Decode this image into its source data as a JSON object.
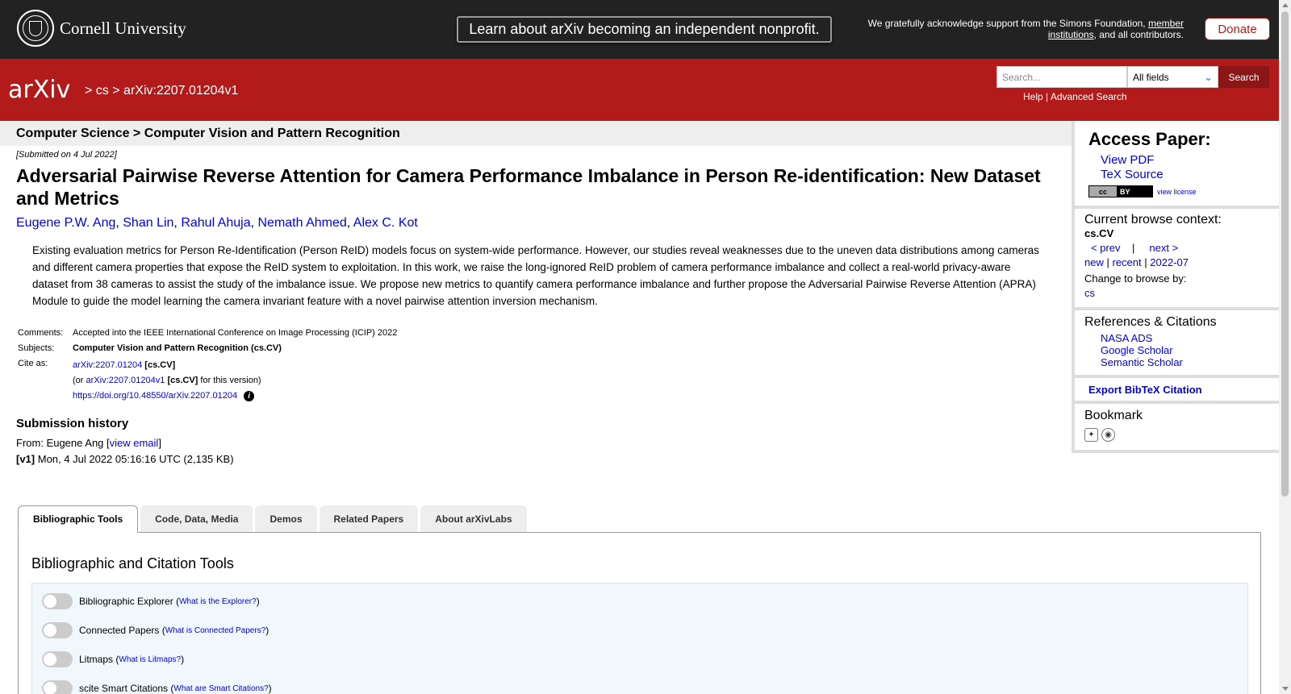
{
  "banner": {
    "cornell_label": "Cornell University",
    "nonprofit_label": "Learn about arXiv becoming an independent nonprofit.",
    "support_prefix": "We gratefully acknowledge support from the Simons Foundation,",
    "support_link": "member institutions",
    "support_suffix": ", and all contributors.",
    "donate_label": "Donate"
  },
  "header": {
    "logo_text": "arXiv",
    "crumb_sep1": ">",
    "crumb_cs": "cs",
    "crumb_sep2": ">",
    "crumb_id": "arXiv:2207.01204v1",
    "search_placeholder": "Search...",
    "search_field": "All fields",
    "search_button": "Search",
    "help": "Help",
    "sep": "|",
    "advanced": "Advanced Search"
  },
  "subheader": "Computer Science > Computer Vision and Pattern Recognition",
  "paper": {
    "submitted": "[Submitted on 4 Jul 2022]",
    "title": "Adversarial Pairwise Reverse Attention for Camera Performance Imbalance in Person Re-identification: New Dataset and Metrics",
    "authors": [
      "Eugene P.W. Ang",
      "Shan Lin",
      "Rahul Ahuja",
      "Nemath Ahmed",
      "Alex C. Kot"
    ],
    "abstract": "Existing evaluation metrics for Person Re-Identification (Person ReID) models focus on system-wide performance. However, our studies reveal weaknesses due to the uneven data distributions among cameras and different camera properties that expose the ReID system to exploitation. In this work, we raise the long-ignored ReID problem of camera performance imbalance and collect a real-world privacy-aware dataset from 38 cameras to assist the study of the imbalance issue. We propose new metrics to quantify camera performance imbalance and further propose the Adversarial Pairwise Reverse Attention (APRA) Module to guide the model learning the camera invariant feature with a novel pairwise attention inversion mechanism.",
    "comments_label": "Comments:",
    "comments": "Accepted into the IEEE International Conference on Image Processing (ICIP) 2022",
    "subjects_label": "Subjects:",
    "subjects": "Computer Vision and Pattern Recognition (cs.CV)",
    "cite_label": "Cite as:",
    "cite_id": "arXiv:2207.01204",
    "cite_cat": "[cs.CV]",
    "cite_or": "(or",
    "cite_version": "arXiv:2207.01204v1",
    "cite_cat2": "[cs.CV]",
    "cite_version_suffix": "for this version)",
    "doi": "https://doi.org/10.48550/arXiv.2207.01204",
    "history_title": "Submission history",
    "from_prefix": "From: Eugene Ang [",
    "view_email": "view email",
    "from_suffix": "]",
    "v1_label": "[v1]",
    "v1_text": "Mon, 4 Jul 2022 05:16:16 UTC (2,135 KB)"
  },
  "sidebar": {
    "access_title": "Access Paper:",
    "view_pdf": "View PDF",
    "tex_source": "TeX Source",
    "cc_label": "cc",
    "cc_by": "BY",
    "view_license": "view license",
    "browse_context": "Current browse context:",
    "context": "cs.CV",
    "prev": "< prev",
    "pipe": "|",
    "next": "next >",
    "new": "new",
    "recent": "recent",
    "month": "2022-07",
    "change_browse": "Change to browse by:",
    "cs": "cs",
    "refs_title": "References & Citations",
    "nasa": "NASA ADS",
    "google": "Google Scholar",
    "semantic": "Semantic Scholar",
    "export": "Export BibTeX Citation",
    "bookmark": "Bookmark"
  },
  "tabs": [
    "Bibliographic Tools",
    "Code, Data, Media",
    "Demos",
    "Related Papers",
    "About arXivLabs"
  ],
  "panel": {
    "title": "Bibliographic and Citation Tools",
    "toggles": [
      {
        "label": "Bibliographic Explorer",
        "link": "What is the Explorer?"
      },
      {
        "label": "Connected Papers",
        "link": "What is Connected Papers?"
      },
      {
        "label": "Litmaps",
        "link": "What is Litmaps?"
      },
      {
        "label": "scite Smart Citations",
        "link": "What are Smart Citations?"
      }
    ]
  },
  "colors": {
    "arxiv_red": "#b31b1b",
    "banner_dark": "#222222",
    "link_blue": "#0000ee"
  }
}
